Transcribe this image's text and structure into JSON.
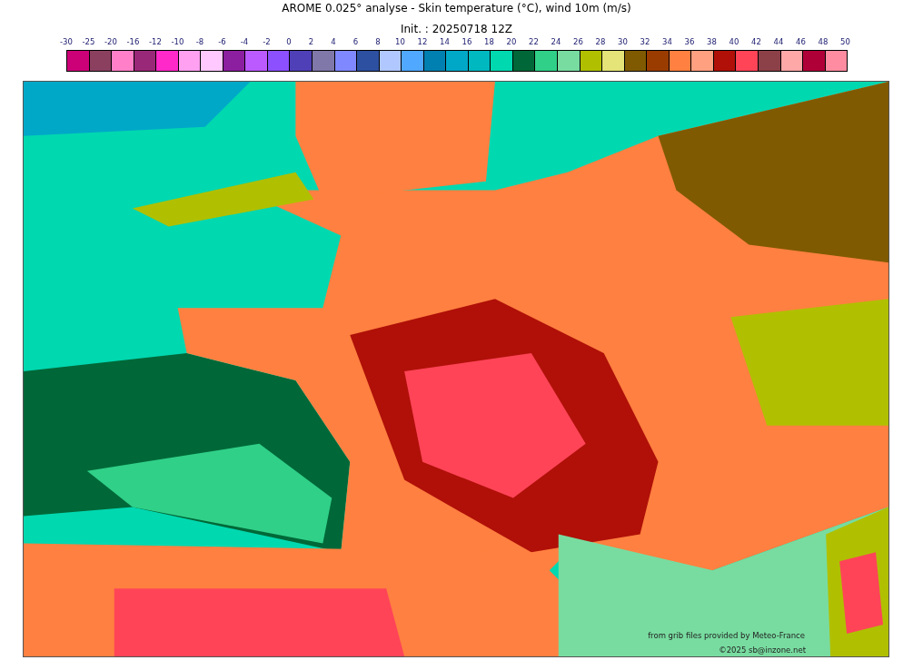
{
  "title": "AROME 0.025° analyse - Skin temperature (°C), wind 10m (m/s)",
  "subtitle": "Init. : 20250718 12Z",
  "colorbar": {
    "ticks": [
      "-30",
      "-25",
      "-20",
      "-16",
      "-12",
      "-10",
      "-8",
      "-6",
      "-4",
      "-2",
      "0",
      "2",
      "4",
      "6",
      "8",
      "10",
      "12",
      "14",
      "16",
      "18",
      "20",
      "22",
      "24",
      "26",
      "28",
      "30",
      "32",
      "34",
      "36",
      "38",
      "40",
      "42",
      "44",
      "46",
      "48",
      "50"
    ],
    "bins": [
      {
        "color": "#cc0077"
      },
      {
        "color": "#8b4060"
      },
      {
        "color": "#ff80c8"
      },
      {
        "color": "#9a2878"
      },
      {
        "color": "#ff28c8"
      },
      {
        "color": "#ffa0f0"
      },
      {
        "color": "#ffc8ff"
      },
      {
        "color": "#8c1ea0"
      },
      {
        "color": "#bb5aff"
      },
      {
        "color": "#8c50ff"
      },
      {
        "color": "#5040b8"
      },
      {
        "color": "#8078a8"
      },
      {
        "color": "#8088ff"
      },
      {
        "color": "#2e50a0"
      },
      {
        "color": "#b0c8ff"
      },
      {
        "color": "#50a8ff"
      },
      {
        "color": "#0080b0"
      },
      {
        "color": "#00a8c8"
      },
      {
        "color": "#00b8c0"
      },
      {
        "color": "#00d8b0"
      },
      {
        "color": "#006838"
      },
      {
        "color": "#30d088"
      },
      {
        "color": "#78dca0"
      },
      {
        "color": "#b0c000"
      },
      {
        "color": "#e4e478"
      },
      {
        "color": "#7f5a00"
      },
      {
        "color": "#9a3c00"
      },
      {
        "color": "#ff8040"
      },
      {
        "color": "#ffa080"
      },
      {
        "color": "#b01008"
      },
      {
        "color": "#ff4458"
      },
      {
        "color": "#8c4048"
      },
      {
        "color": "#ffa8a8"
      },
      {
        "color": "#b00038"
      },
      {
        "color": "#ff8ca0"
      }
    ]
  },
  "credits": [
    "from grib files provided by  Meteo-France",
    "©2025 sb@inzone.net"
  ]
}
